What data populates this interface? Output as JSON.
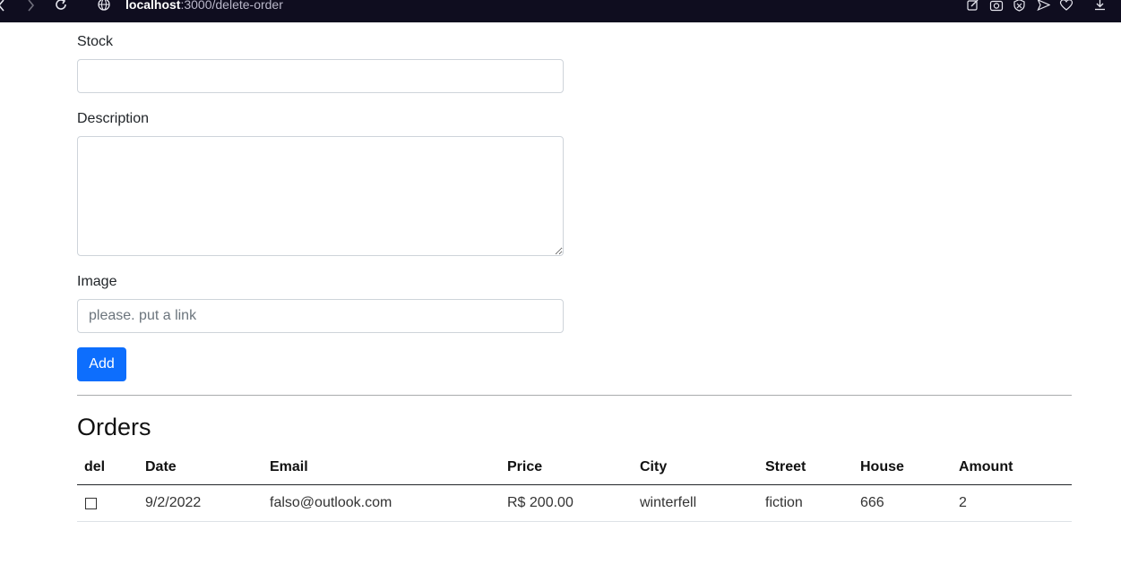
{
  "browser": {
    "url_host": "localhost",
    "url_path": ":3000/delete-order"
  },
  "form": {
    "stock_label": "Stock",
    "stock_value": "",
    "description_label": "Description",
    "description_value": "",
    "image_label": "Image",
    "image_placeholder": "please. put a link",
    "add_button": "Add"
  },
  "orders": {
    "title": "Orders",
    "columns": [
      "del",
      "Date",
      "Email",
      "Price",
      "City",
      "Street",
      "House",
      "Amount"
    ],
    "rows": [
      {
        "del": false,
        "date": "9/2/2022",
        "email": "falso@outlook.com",
        "price": "R$ 200.00",
        "city": "winterfell",
        "street": "fiction",
        "house": "666",
        "amount": "2"
      }
    ]
  },
  "colors": {
    "chrome_bg": "#0f0d1f",
    "primary_button": "#0d6efd"
  }
}
